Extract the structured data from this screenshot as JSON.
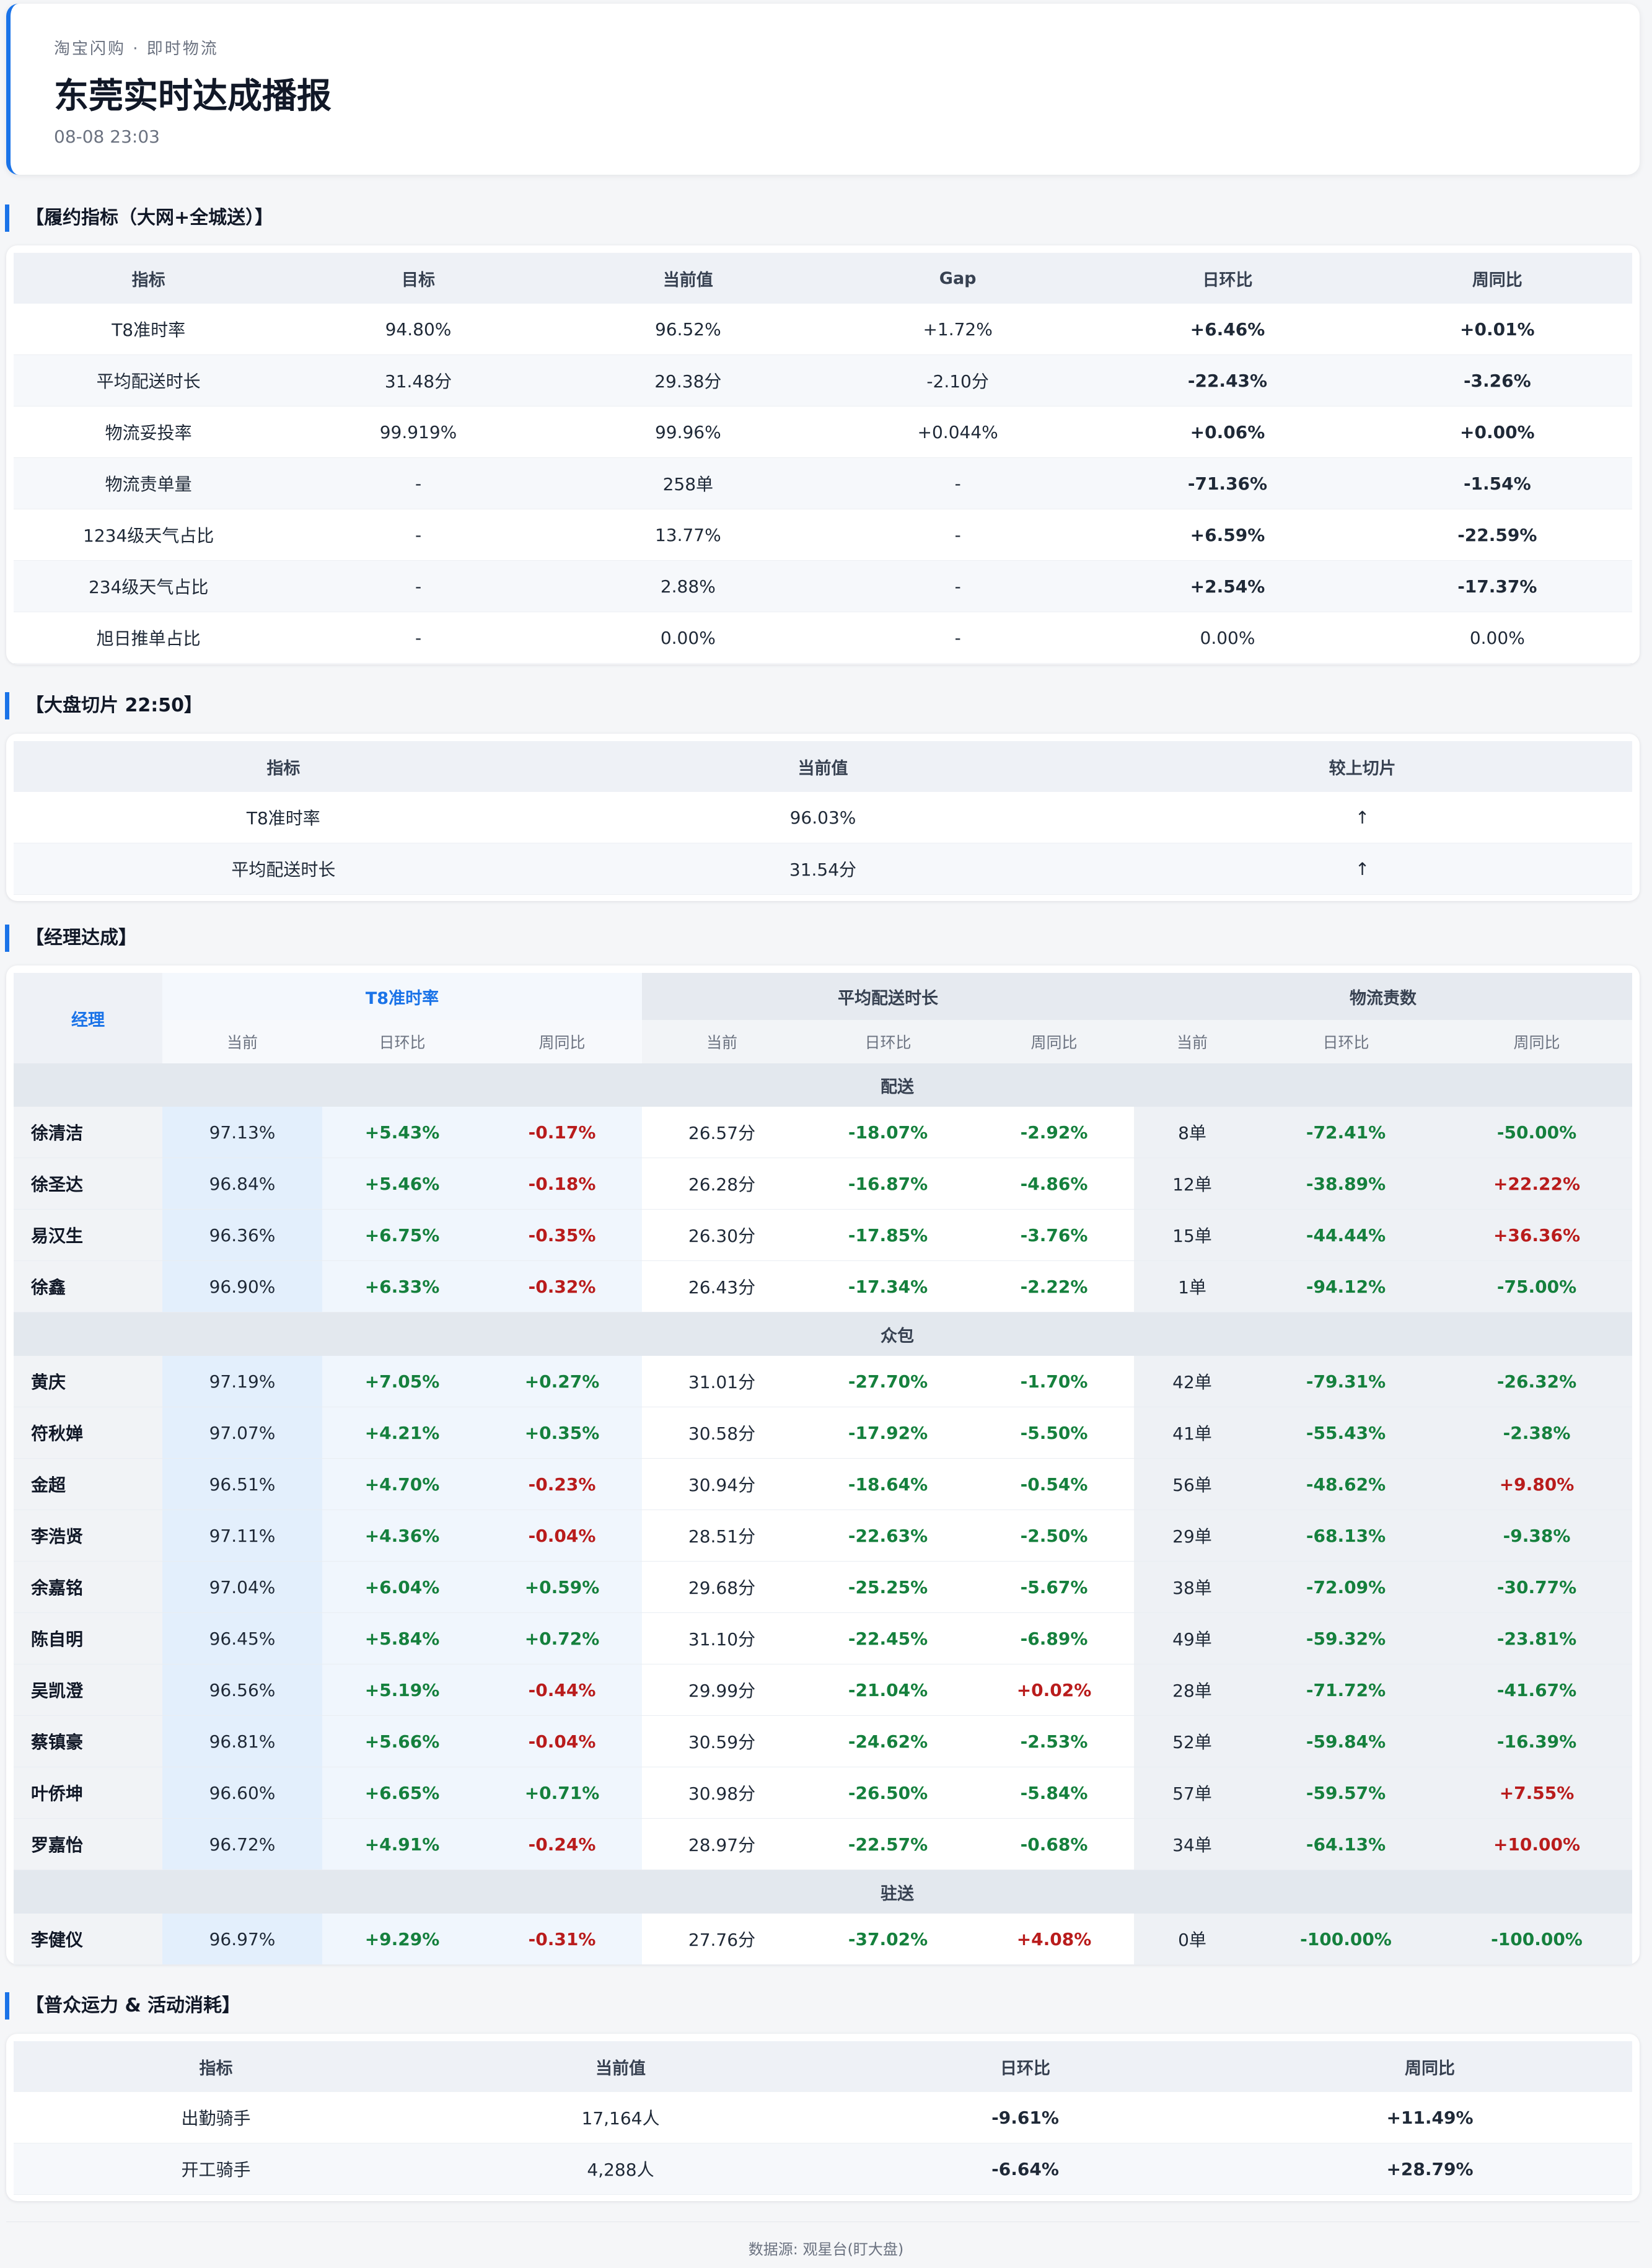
{
  "header": {
    "subtitle": "淘宝闪购 · 即时物流",
    "title": "东莞实时达成播报",
    "time": "08-08 23:03"
  },
  "fulfillment": {
    "title": "【履约指标（大网+全城送）】",
    "columns": [
      "指标",
      "目标",
      "当前值",
      "Gap",
      "日环比",
      "周同比"
    ],
    "rows": [
      {
        "c": [
          "T8准时率",
          "94.80%",
          "96.52%",
          "+1.72%",
          "+6.46%",
          "+0.01%"
        ],
        "s": [
          "",
          "",
          "",
          "",
          "pos",
          "pos"
        ]
      },
      {
        "c": [
          "平均配送时长",
          "31.48分",
          "29.38分",
          "-2.10分",
          "-22.43%",
          "-3.26%"
        ],
        "s": [
          "",
          "",
          "",
          "",
          "pos",
          "pos"
        ]
      },
      {
        "c": [
          "物流妥投率",
          "99.919%",
          "99.96%",
          "+0.044%",
          "+0.06%",
          "+0.00%"
        ],
        "s": [
          "",
          "",
          "",
          "",
          "pos",
          "pos"
        ]
      },
      {
        "c": [
          "物流责单量",
          "-",
          "258单",
          "-",
          "-71.36%",
          "-1.54%"
        ],
        "s": [
          "",
          "",
          "",
          "",
          "pos",
          "pos"
        ]
      },
      {
        "c": [
          "1234级天气占比",
          "-",
          "13.77%",
          "-",
          "+6.59%",
          "-22.59%"
        ],
        "s": [
          "",
          "",
          "",
          "",
          "neg",
          "pos"
        ]
      },
      {
        "c": [
          "234级天气占比",
          "-",
          "2.88%",
          "-",
          "+2.54%",
          "-17.37%"
        ],
        "s": [
          "",
          "",
          "",
          "",
          "neg",
          "pos"
        ]
      },
      {
        "c": [
          "旭日推单占比",
          "-",
          "0.00%",
          "-",
          "0.00%",
          "0.00%"
        ],
        "s": [
          "",
          "",
          "",
          "",
          "neutral",
          "neutral"
        ]
      }
    ]
  },
  "slice": {
    "title": "【大盘切片 22:50】",
    "columns": [
      "指标",
      "当前值",
      "较上切片"
    ],
    "rows": [
      {
        "c": [
          "T8准时率",
          "96.03%",
          "↑"
        ]
      },
      {
        "c": [
          "平均配送时长",
          "31.54分",
          "↑"
        ]
      }
    ]
  },
  "managers": {
    "title": "【经理达成】",
    "manager_header": "经理",
    "groups": [
      "T8准时率",
      "平均配送时长",
      "物流责数"
    ],
    "sub_columns": [
      "当前",
      "日环比",
      "周同比",
      "当前",
      "日环比",
      "周同比",
      "当前",
      "日环比",
      "周同比"
    ],
    "sections": [
      {
        "name": "配送",
        "rows": [
          {
            "c": [
              "徐清洁",
              "97.13%",
              "+5.43%",
              "-0.17%",
              "26.57分",
              "-18.07%",
              "-2.92%",
              "8单",
              "-72.41%",
              "-50.00%"
            ],
            "s": [
              "",
              "",
              "pos",
              "neg",
              "",
              "pos",
              "pos",
              "",
              "pos",
              "pos"
            ]
          },
          {
            "c": [
              "徐圣达",
              "96.84%",
              "+5.46%",
              "-0.18%",
              "26.28分",
              "-16.87%",
              "-4.86%",
              "12单",
              "-38.89%",
              "+22.22%"
            ],
            "s": [
              "",
              "",
              "pos",
              "neg",
              "",
              "pos",
              "pos",
              "",
              "pos",
              "neg"
            ]
          },
          {
            "c": [
              "易汉生",
              "96.36%",
              "+6.75%",
              "-0.35%",
              "26.30分",
              "-17.85%",
              "-3.76%",
              "15单",
              "-44.44%",
              "+36.36%"
            ],
            "s": [
              "",
              "",
              "pos",
              "neg",
              "",
              "pos",
              "pos",
              "",
              "pos",
              "neg"
            ]
          },
          {
            "c": [
              "徐鑫",
              "96.90%",
              "+6.33%",
              "-0.32%",
              "26.43分",
              "-17.34%",
              "-2.22%",
              "1单",
              "-94.12%",
              "-75.00%"
            ],
            "s": [
              "",
              "",
              "pos",
              "neg",
              "",
              "pos",
              "pos",
              "",
              "pos",
              "pos"
            ]
          }
        ]
      },
      {
        "name": "众包",
        "rows": [
          {
            "c": [
              "黄庆",
              "97.19%",
              "+7.05%",
              "+0.27%",
              "31.01分",
              "-27.70%",
              "-1.70%",
              "42单",
              "-79.31%",
              "-26.32%"
            ],
            "s": [
              "",
              "",
              "pos",
              "pos",
              "",
              "pos",
              "pos",
              "",
              "pos",
              "pos"
            ]
          },
          {
            "c": [
              "符秋婵",
              "97.07%",
              "+4.21%",
              "+0.35%",
              "30.58分",
              "-17.92%",
              "-5.50%",
              "41单",
              "-55.43%",
              "-2.38%"
            ],
            "s": [
              "",
              "",
              "pos",
              "pos",
              "",
              "pos",
              "pos",
              "",
              "pos",
              "pos"
            ]
          },
          {
            "c": [
              "金超",
              "96.51%",
              "+4.70%",
              "-0.23%",
              "30.94分",
              "-18.64%",
              "-0.54%",
              "56单",
              "-48.62%",
              "+9.80%"
            ],
            "s": [
              "",
              "",
              "pos",
              "neg",
              "",
              "pos",
              "pos",
              "",
              "pos",
              "neg"
            ]
          },
          {
            "c": [
              "李浩贤",
              "97.11%",
              "+4.36%",
              "-0.04%",
              "28.51分",
              "-22.63%",
              "-2.50%",
              "29单",
              "-68.13%",
              "-9.38%"
            ],
            "s": [
              "",
              "",
              "pos",
              "neg",
              "",
              "pos",
              "pos",
              "",
              "pos",
              "pos"
            ]
          },
          {
            "c": [
              "余嘉铭",
              "97.04%",
              "+6.04%",
              "+0.59%",
              "29.68分",
              "-25.25%",
              "-5.67%",
              "38单",
              "-72.09%",
              "-30.77%"
            ],
            "s": [
              "",
              "",
              "pos",
              "pos",
              "",
              "pos",
              "pos",
              "",
              "pos",
              "pos"
            ]
          },
          {
            "c": [
              "陈自明",
              "96.45%",
              "+5.84%",
              "+0.72%",
              "31.10分",
              "-22.45%",
              "-6.89%",
              "49单",
              "-59.32%",
              "-23.81%"
            ],
            "s": [
              "",
              "",
              "pos",
              "pos",
              "",
              "pos",
              "pos",
              "",
              "pos",
              "pos"
            ]
          },
          {
            "c": [
              "吴凯澄",
              "96.56%",
              "+5.19%",
              "-0.44%",
              "29.99分",
              "-21.04%",
              "+0.02%",
              "28单",
              "-71.72%",
              "-41.67%"
            ],
            "s": [
              "",
              "",
              "pos",
              "neg",
              "",
              "pos",
              "neg",
              "",
              "pos",
              "pos"
            ]
          },
          {
            "c": [
              "蔡镇豪",
              "96.81%",
              "+5.66%",
              "-0.04%",
              "30.59分",
              "-24.62%",
              "-2.53%",
              "52单",
              "-59.84%",
              "-16.39%"
            ],
            "s": [
              "",
              "",
              "pos",
              "neg",
              "",
              "pos",
              "pos",
              "",
              "pos",
              "pos"
            ]
          },
          {
            "c": [
              "叶侨坤",
              "96.60%",
              "+6.65%",
              "+0.71%",
              "30.98分",
              "-26.50%",
              "-5.84%",
              "57单",
              "-59.57%",
              "+7.55%"
            ],
            "s": [
              "",
              "",
              "pos",
              "pos",
              "",
              "pos",
              "pos",
              "",
              "pos",
              "neg"
            ]
          },
          {
            "c": [
              "罗嘉怡",
              "96.72%",
              "+4.91%",
              "-0.24%",
              "28.97分",
              "-22.57%",
              "-0.68%",
              "34单",
              "-64.13%",
              "+10.00%"
            ],
            "s": [
              "",
              "",
              "pos",
              "neg",
              "",
              "pos",
              "pos",
              "",
              "pos",
              "neg"
            ]
          }
        ]
      },
      {
        "name": "驻送",
        "rows": [
          {
            "c": [
              "李健仪",
              "96.97%",
              "+9.29%",
              "-0.31%",
              "27.76分",
              "-37.02%",
              "+4.08%",
              "0单",
              "-100.00%",
              "-100.00%"
            ],
            "s": [
              "",
              "",
              "pos",
              "neg",
              "",
              "pos",
              "neg",
              "",
              "pos",
              "pos"
            ]
          }
        ]
      }
    ]
  },
  "capacity": {
    "title": "【普众运力 & 活动消耗】",
    "columns": [
      "指标",
      "当前值",
      "日环比",
      "周同比"
    ],
    "rows": [
      {
        "c": [
          "出勤骑手",
          "17,164人",
          "-9.61%",
          "+11.49%"
        ],
        "s": [
          "",
          "",
          "neg",
          "pos"
        ]
      },
      {
        "c": [
          "开工骑手",
          "4,288人",
          "-6.64%",
          "+28.79%"
        ],
        "s": [
          "",
          "",
          "neg",
          "pos"
        ]
      }
    ]
  },
  "footer": "数据源: 观星台(盯大盘)"
}
